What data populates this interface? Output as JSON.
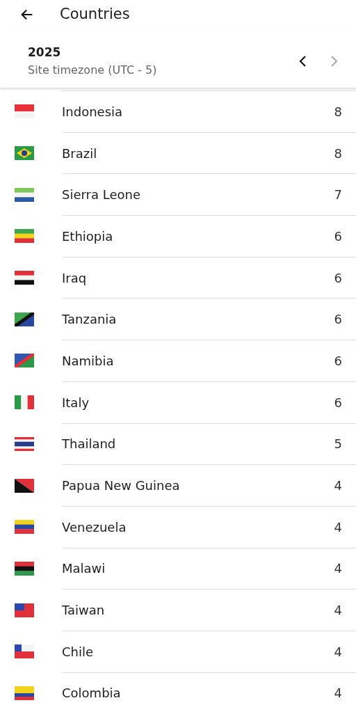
{
  "app_bar": {
    "title": "Countries"
  },
  "period": {
    "year": "2025",
    "timezone": "Site timezone (UTC - 5)",
    "prev_enabled": true,
    "next_enabled": false
  },
  "countries": [
    {
      "name": "Indonesia",
      "count": "8",
      "flag": {
        "kind": "h",
        "stripes": [
          {
            "color": "#e8303a"
          },
          {
            "color": "#f4f4f4"
          }
        ]
      }
    },
    {
      "name": "Brazil",
      "count": "8",
      "flag": {
        "kind": "diamond",
        "stripes": [
          {
            "color": "#2a9a48"
          },
          {
            "color": "#f2d21a"
          },
          {
            "color": "#243f8c"
          }
        ]
      }
    },
    {
      "name": "Sierra Leone",
      "count": "7",
      "flag": {
        "kind": "h",
        "stripes": [
          {
            "color": "#7ec85a"
          },
          {
            "color": "#f4f4f4"
          },
          {
            "color": "#2c58a8"
          }
        ]
      }
    },
    {
      "name": "Ethiopia",
      "count": "6",
      "flag": {
        "kind": "h",
        "stripes": [
          {
            "color": "#3ea64e"
          },
          {
            "color": "#f2d21a"
          },
          {
            "color": "#e0303a"
          }
        ]
      }
    },
    {
      "name": "Iraq",
      "count": "6",
      "flag": {
        "kind": "h",
        "stripes": [
          {
            "color": "#e0303a"
          },
          {
            "color": "#f4f4f4"
          },
          {
            "color": "#111111"
          }
        ]
      }
    },
    {
      "name": "Tanzania",
      "count": "6",
      "flag": {
        "kind": "diag",
        "stripes": [
          {
            "color": "#3ea64e"
          },
          {
            "color": "#111111"
          },
          {
            "color": "#2848a0"
          }
        ]
      }
    },
    {
      "name": "Namibia",
      "count": "6",
      "flag": {
        "kind": "diag",
        "stripes": [
          {
            "color": "#3058b0"
          },
          {
            "color": "#e0303a"
          },
          {
            "color": "#2a9a48"
          }
        ]
      }
    },
    {
      "name": "Italy",
      "count": "6",
      "flag": {
        "kind": "v",
        "stripes": [
          {
            "color": "#2a9a48"
          },
          {
            "color": "#f4f4f4"
          },
          {
            "color": "#e0303a"
          }
        ]
      }
    },
    {
      "name": "Thailand",
      "count": "5",
      "flag": {
        "kind": "thai",
        "stripes": [
          {
            "color": "#e0303a"
          },
          {
            "color": "#f4f4f4"
          },
          {
            "color": "#2c3c8c"
          }
        ]
      }
    },
    {
      "name": "Papua New Guinea",
      "count": "4",
      "flag": {
        "kind": "diag2",
        "stripes": [
          {
            "color": "#111111"
          },
          {
            "color": "#e0303a"
          }
        ]
      }
    },
    {
      "name": "Venezuela",
      "count": "4",
      "flag": {
        "kind": "h",
        "stripes": [
          {
            "color": "#f2d21a"
          },
          {
            "color": "#2848a0"
          },
          {
            "color": "#e0303a"
          }
        ]
      }
    },
    {
      "name": "Malawi",
      "count": "4",
      "flag": {
        "kind": "h",
        "stripes": [
          {
            "color": "#e0303a"
          },
          {
            "color": "#111111"
          },
          {
            "color": "#2a9a48"
          }
        ]
      }
    },
    {
      "name": "Taiwan",
      "count": "4",
      "flag": {
        "kind": "canton",
        "stripes": [
          {
            "color": "#e0303a"
          },
          {
            "color": "#2c48b0"
          }
        ]
      }
    },
    {
      "name": "Chile",
      "count": "4",
      "flag": {
        "kind": "canton2",
        "stripes": [
          {
            "color": "#f4f4f4"
          },
          {
            "color": "#e0303a"
          },
          {
            "color": "#2c48b0"
          }
        ]
      }
    },
    {
      "name": "Colombia",
      "count": "4",
      "flag": {
        "kind": "colombia",
        "stripes": [
          {
            "color": "#f2d21a"
          },
          {
            "color": "#2848a0"
          },
          {
            "color": "#e0303a"
          }
        ]
      }
    }
  ]
}
